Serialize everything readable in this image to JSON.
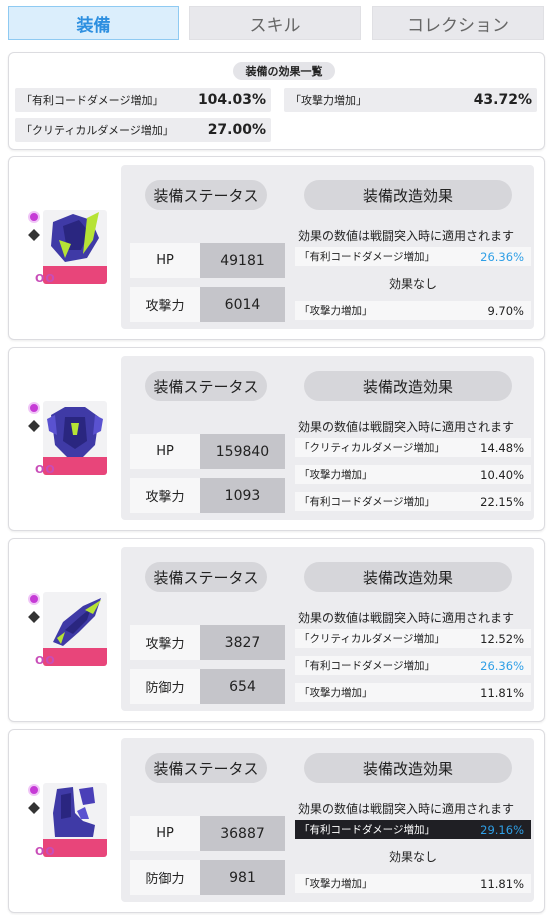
{
  "tabs": [
    {
      "label": "装備"
    },
    {
      "label": "スキル"
    },
    {
      "label": "コレクション"
    }
  ],
  "summary": {
    "title": "装備の効果一覧",
    "rows": [
      {
        "name": "「有利コードダメージ増加」",
        "value": "104.03%"
      },
      {
        "name": "「攻撃力増加」",
        "value": "43.72%"
      },
      {
        "name": "「クリティカルダメージ増加」",
        "value": "27.00%"
      }
    ]
  },
  "common": {
    "status_title": "装備ステータス",
    "mod_title": "装備改造効果",
    "note": "効果の数値は戦闘突入時に適用されます",
    "none": "効果なし",
    "level_mark": "OO"
  },
  "cards": [
    {
      "stats": [
        {
          "label": "HP",
          "value": "49181"
        },
        {
          "label": "攻撃力",
          "value": "6014"
        }
      ],
      "effects": [
        {
          "name": "「有利コードダメージ増加」",
          "value": "26.36%",
          "style": "blue"
        },
        {
          "none": true
        },
        {
          "name": "「攻撃力増加」",
          "value": "9.70%",
          "style": "normal"
        }
      ]
    },
    {
      "stats": [
        {
          "label": "HP",
          "value": "159840"
        },
        {
          "label": "攻撃力",
          "value": "1093"
        }
      ],
      "effects": [
        {
          "name": "「クリティカルダメージ増加」",
          "value": "14.48%",
          "style": "normal"
        },
        {
          "name": "「攻撃力増加」",
          "value": "10.40%",
          "style": "normal"
        },
        {
          "name": "「有利コードダメージ増加」",
          "value": "22.15%",
          "style": "normal"
        }
      ]
    },
    {
      "stats": [
        {
          "label": "攻撃力",
          "value": "3827"
        },
        {
          "label": "防御力",
          "value": "654"
        }
      ],
      "effects": [
        {
          "name": "「クリティカルダメージ増加」",
          "value": "12.52%",
          "style": "normal"
        },
        {
          "name": "「有利コードダメージ増加」",
          "value": "26.36%",
          "style": "blue"
        },
        {
          "name": "「攻撃力増加」",
          "value": "11.81%",
          "style": "normal"
        }
      ]
    },
    {
      "stats": [
        {
          "label": "HP",
          "value": "36887"
        },
        {
          "label": "防御力",
          "value": "981"
        }
      ],
      "effects": [
        {
          "name": "「有利コードダメージ増加」",
          "value": "29.16%",
          "style": "dark"
        },
        {
          "none": true
        },
        {
          "name": "「攻撃力増加」",
          "value": "11.81%",
          "style": "normal"
        }
      ]
    }
  ],
  "colors": {
    "accent": "#2d8fe0",
    "highlight": "#2f9fe6",
    "pink": "#e8457a",
    "equip_purple": "#4a3fb8"
  }
}
